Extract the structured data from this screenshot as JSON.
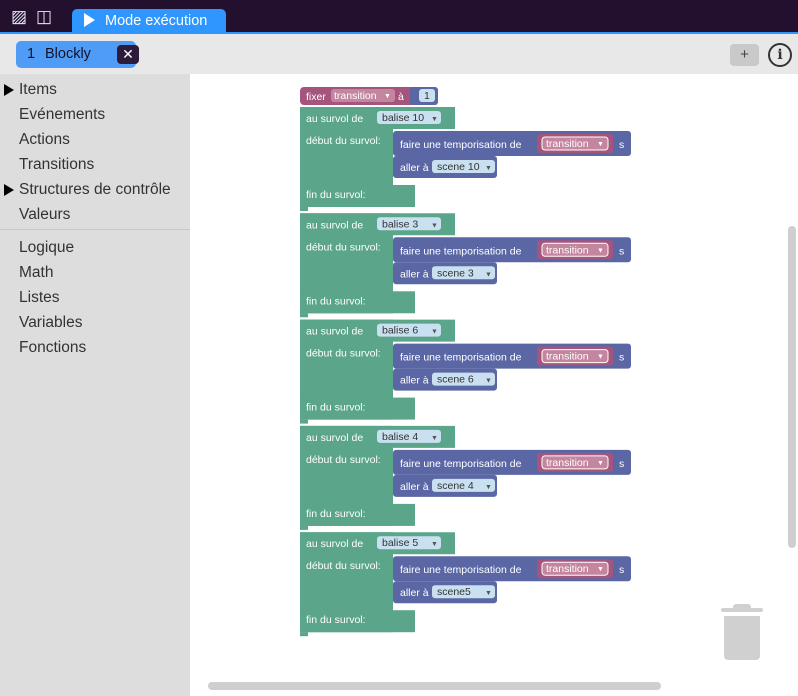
{
  "topbar": {
    "icons": [
      "layers-icon",
      "panel-icon"
    ],
    "tab_label": "Mode exécution"
  },
  "secondary": {
    "chip_number": "1",
    "chip_label": "Blockly",
    "chip_close": "✕",
    "add_label": "+",
    "info_label": "i"
  },
  "sidebar": {
    "items": [
      {
        "label": "Items",
        "expandable": true
      },
      {
        "label": "Evénements",
        "expandable": false
      },
      {
        "label": "Actions",
        "expandable": false
      },
      {
        "label": "Transitions",
        "expandable": false
      },
      {
        "label": "Structures de contrôle",
        "expandable": true
      },
      {
        "label": "Valeurs",
        "expandable": false
      },
      {
        "label": "Logique",
        "expandable": false
      },
      {
        "label": "Math",
        "expandable": false
      },
      {
        "label": "Listes",
        "expandable": false
      },
      {
        "label": "Variables",
        "expandable": false
      },
      {
        "label": "Fonctions",
        "expandable": false
      }
    ]
  },
  "workspace": {
    "colors": {
      "variable": "#a5547e",
      "event": "#5ba58b",
      "action": "#5b67a5",
      "field": "#c9e0f0"
    },
    "set_block": {
      "label": "fixer",
      "variable": "transition",
      "to_label": "à",
      "value": "1"
    },
    "labels": {
      "hover_of": "au survol de",
      "hover_start": "début du survol:",
      "hover_end": "fin du survol:",
      "delay": "faire une temporisation de",
      "delay_var": "transition",
      "delay_unit": "s",
      "goto": "aller à"
    },
    "handlers": [
      {
        "tag": "balise 10",
        "scene": "scene 10"
      },
      {
        "tag": "balise 3",
        "scene": "scene 3"
      },
      {
        "tag": "balise 6",
        "scene": "scene 6"
      },
      {
        "tag": "balise 4",
        "scene": "scene 4"
      },
      {
        "tag": "balise 5",
        "scene": "scene5"
      }
    ]
  }
}
